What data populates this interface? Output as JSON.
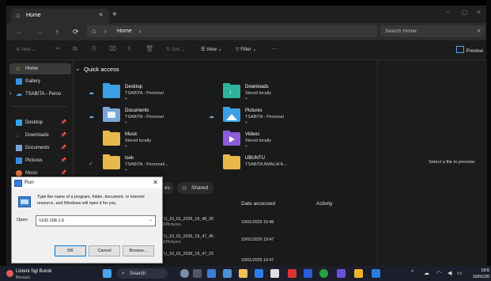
{
  "window": {
    "tab_title": "Home",
    "tab_close": "×",
    "new_tab": "+",
    "controls": [
      "–",
      "▢",
      "✕"
    ]
  },
  "navigation": {
    "back": "←",
    "forward": "→",
    "up": "↑",
    "refresh": "⟳",
    "breadcrumb": [
      "Home"
    ],
    "search_placeholder": "Search Home"
  },
  "commandbar": {
    "new_label": "New",
    "sort_label": "Sort",
    "view_label": "View",
    "filter_label": "Filter",
    "more_label": "···",
    "preview_label": "Preview"
  },
  "sidebar": {
    "items": [
      {
        "label": "Home",
        "icon": "home-icon",
        "pinned": false
      },
      {
        "label": "Gallery",
        "icon": "gallery-icon",
        "pinned": false
      },
      {
        "label": "TSABITA - Perso",
        "icon": "onedrive-icon",
        "pinned": false
      },
      {
        "label": "Desktop",
        "icon": "desktop-icon",
        "pinned": true
      },
      {
        "label": "Downloads",
        "icon": "download-icon",
        "pinned": true
      },
      {
        "label": "Documents",
        "icon": "documents-icon",
        "pinned": true
      },
      {
        "label": "Pictures",
        "icon": "pictures-icon",
        "pinned": true
      },
      {
        "label": "Music",
        "icon": "music-icon",
        "pinned": true
      }
    ]
  },
  "quick_access": {
    "heading": "Quick access",
    "tiles": [
      {
        "name": "Desktop",
        "location": "TSABITA - Personal",
        "color": "#3ba0e6",
        "status": "cloud"
      },
      {
        "name": "Downloads",
        "location": "Stored locally",
        "color": "#2fb39c",
        "status": ""
      },
      {
        "name": "Documents",
        "location": "TSABITA - Personal",
        "color": "#7aa6d6",
        "status": "cloud"
      },
      {
        "name": "Pictures",
        "location": "TSABITA - Personal",
        "color": "#3ba0e6",
        "status": "cloud"
      },
      {
        "name": "Music",
        "location": "Stored locally",
        "color": "#e7714a",
        "status": ""
      },
      {
        "name": "Videos",
        "location": "Stored locally",
        "color": "#8c5bd9",
        "status": ""
      },
      {
        "name": "tsek",
        "location": "TSABITA - Personal\\...",
        "color": "#e8b84a",
        "status": "synced"
      },
      {
        "name": "UBUNTU",
        "location": "TSABITA AMALIA A...",
        "color": "#e8b84a",
        "status": ""
      }
    ]
  },
  "recent": {
    "filter_left": "es",
    "filter_shared": "Shared",
    "col_date": "Date accessed",
    "col_activity": "Activity",
    "rows": [
      {
        "name": "TU_10_01_2026_19_48_26",
        "path": "al\\Pictures",
        "date": "10/01/2026 19:48"
      },
      {
        "name": "TU_10_01_2026_19_47_45",
        "path": "al\\Pictures",
        "date": "10/01/2026 19:47"
      },
      {
        "name": "TU_10_01_2026_19_47_23",
        "path": "",
        "date": "10/01/2026 19:47"
      }
    ]
  },
  "preview_pane": {
    "message": "Select a file to preview."
  },
  "run_dialog": {
    "title": "Run",
    "description": "Type the name of a program, folder, document, or Internet resource, and Windows will open it for you.",
    "open_label": "Open:",
    "open_value": "\\\\192.168.1.6",
    "ok": "OK",
    "cancel": "Cancel",
    "browse": "Browse..."
  },
  "taskbar": {
    "weather_title": "Listeni Sgt Buruk",
    "weather_sub": "Berasic",
    "search_label": "Search",
    "tray_time": "19:5",
    "tray_date": "10/01/20"
  }
}
